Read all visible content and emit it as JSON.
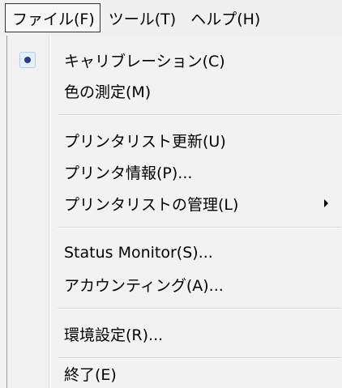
{
  "menubar": {
    "items": [
      {
        "label": "ファイル(F)"
      },
      {
        "label": "ツール(T)"
      },
      {
        "label": "ヘルプ(H)"
      }
    ]
  },
  "file_menu": {
    "items": [
      {
        "label": "キャリブレーション(C)",
        "checked": true
      },
      {
        "label": "色の測定(M)"
      },
      {
        "label": "プリンタリスト更新(U)"
      },
      {
        "label": "プリンタ情報(P)..."
      },
      {
        "label": "プリンタリストの管理(L)",
        "submenu": true
      },
      {
        "label": "Status Monitor(S)..."
      },
      {
        "label": "アカウンティング(A)..."
      },
      {
        "label": "環境設定(R)..."
      },
      {
        "label": "終了(E)"
      }
    ]
  }
}
